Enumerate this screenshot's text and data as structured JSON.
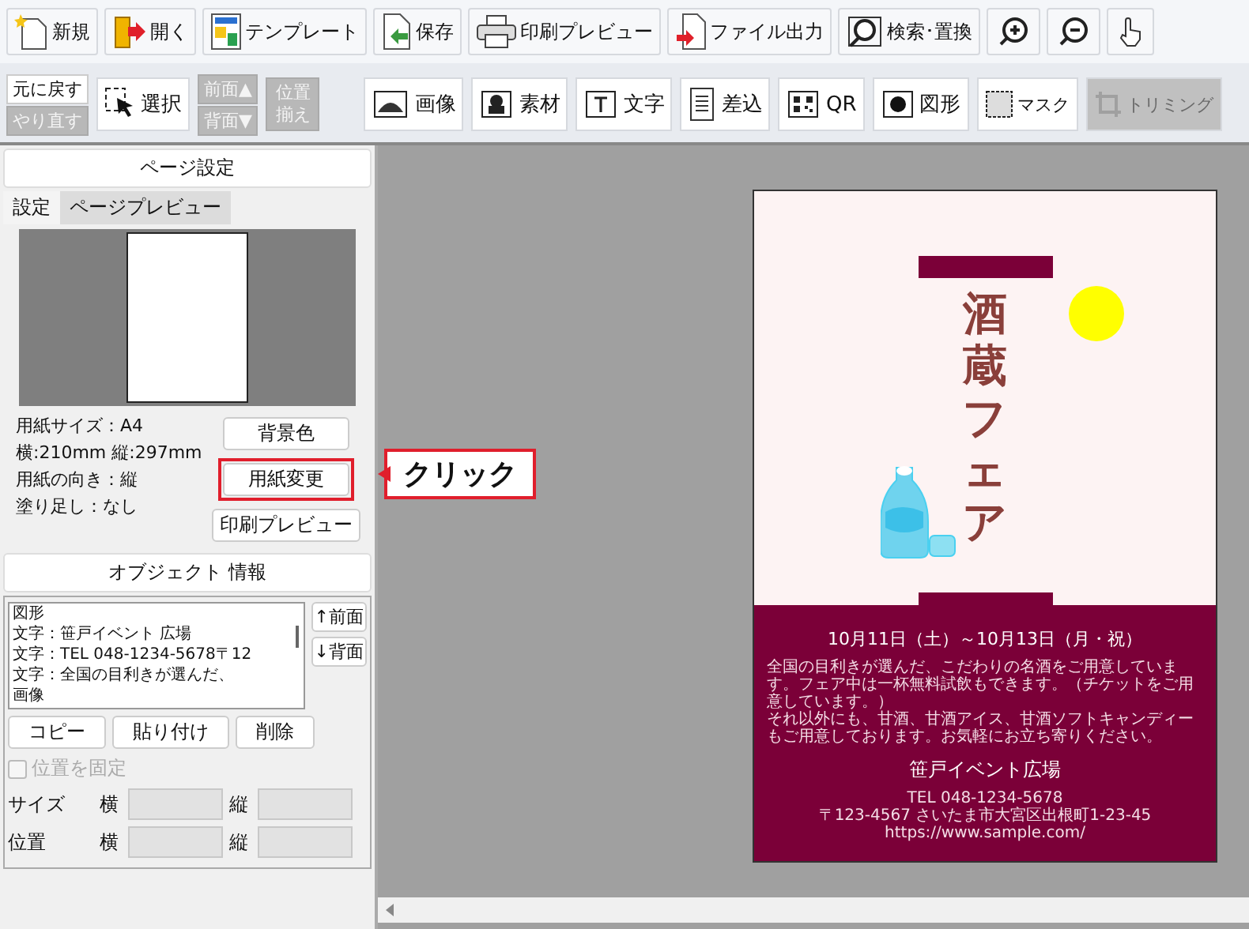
{
  "toolbar": [
    {
      "kind": "new",
      "label": "新規"
    },
    {
      "kind": "open",
      "label": "開く"
    },
    {
      "kind": "template",
      "label": "テンプレート"
    },
    {
      "kind": "save",
      "label": "保存"
    },
    {
      "kind": "print",
      "label": "印刷プレビュー"
    },
    {
      "kind": "export",
      "label": "ファイル出力"
    },
    {
      "kind": "search",
      "label": "検索･置換"
    },
    {
      "kind": "zoom-in"
    },
    {
      "kind": "zoom-out"
    },
    {
      "kind": "hand"
    }
  ],
  "edit_tools": {
    "undo": {
      "label": "元に戻す",
      "disabled": false
    },
    "redo": {
      "label": "やり直す",
      "disabled": true
    },
    "select": {
      "label": "選択"
    },
    "front": {
      "label": "前面▲",
      "disabled": true
    },
    "back": {
      "label": "背面▼",
      "disabled": true
    },
    "align": {
      "label": "位置揃え",
      "disabled": true
    }
  },
  "insert_tools": [
    {
      "kind": "image",
      "label": "画像",
      "disabled": false
    },
    {
      "kind": "material",
      "label": "素材",
      "disabled": false
    },
    {
      "kind": "text",
      "label": "文字",
      "disabled": false
    },
    {
      "kind": "merge",
      "label": "差込",
      "disabled": false
    },
    {
      "kind": "qr",
      "label": "QR",
      "disabled": false
    },
    {
      "kind": "shape",
      "label": "図形",
      "disabled": false
    },
    {
      "kind": "mask",
      "label": "マスク",
      "disabled": false
    },
    {
      "kind": "trim",
      "label": "トリミング",
      "disabled": true
    }
  ],
  "page_settings": {
    "title": "ページ設定",
    "tabs": [
      {
        "label": "設定",
        "selected": true
      },
      {
        "label": "ページプレビュー",
        "selected": false
      }
    ],
    "info": [
      "用紙サイズ：A4",
      "横:210mm 縦:297mm",
      "用紙の向き：縦",
      "塗り足し：なし"
    ],
    "buttons": [
      {
        "label": "背景色",
        "highlighted": false
      },
      {
        "label": "用紙変更",
        "highlighted": true
      },
      {
        "label": "印刷プレビュー",
        "highlighted": false
      }
    ]
  },
  "callout": {
    "label": "クリック"
  },
  "object_info": {
    "title": "オブジェクト 情報",
    "objects": [
      "図形",
      "文字：笹戸イベント 広場",
      "文字：TEL 048-1234-5678〒12",
      "文字：全国の目利きが選んだ、",
      "画像"
    ],
    "order_buttons": [
      "↑前面",
      "↓背面"
    ],
    "buttons": [
      "コピー",
      "貼り付け",
      "削除"
    ],
    "lock": {
      "label": "位置を固定",
      "checked": false,
      "disabled": true
    },
    "rows": [
      {
        "label": "サイズ",
        "x_label": "横",
        "y_label": "縦"
      },
      {
        "label": "位置",
        "x_label": "横",
        "y_label": "縦"
      }
    ]
  },
  "poster": {
    "title": [
      "酒",
      "蔵",
      "フ",
      "ェ",
      "ア"
    ],
    "date": "10月11日（土）～10月13日（月・祝）",
    "paragraphs": [
      "全国の目利きが選んだ、こだわりの名酒をご用意しています。フェア中は一杯無料試飲もできます。（チケットをご用意しています。）",
      "それ以外にも、甘酒、甘酒アイス、甘酒ソフトキャンディーもご用意しております。お気軽にお立ち寄りください。"
    ],
    "venue": "笹戸イベント広場",
    "contact": [
      "TEL 048-1234-5678",
      "〒123-4567 さいたま市大宮区出根町1-23-45",
      "https://www.sample.com/"
    ]
  }
}
